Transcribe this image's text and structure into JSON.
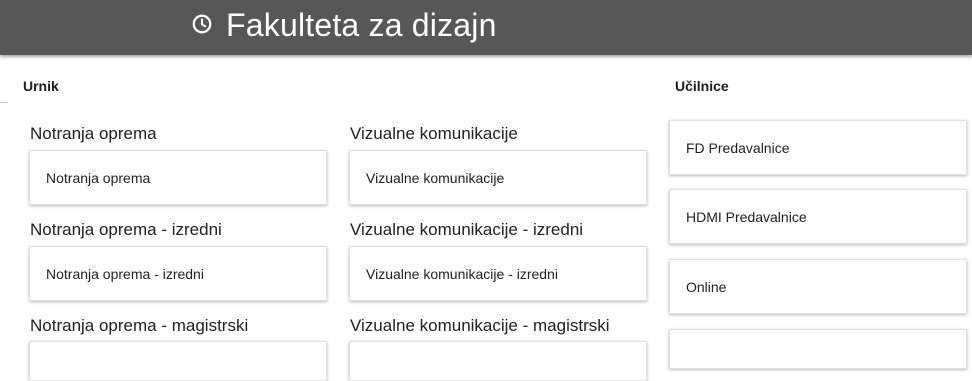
{
  "header": {
    "title": "Fakulteta za dizajn",
    "icon": "clock-icon",
    "background": "#575757"
  },
  "schedule": {
    "label": "Urnik",
    "groups": [
      {
        "title": "Notranja oprema",
        "card": "Notranja oprema"
      },
      {
        "title": "Vizualne komunikacije",
        "card": "Vizualne komunikacije"
      },
      {
        "title": "Notranja oprema - izredni",
        "card": "Notranja oprema - izredni"
      },
      {
        "title": "Vizualne komunikacije - izredni",
        "card": "Vizualne komunikacije - izredni"
      },
      {
        "title": "Notranja oprema - magistrski",
        "card": ""
      },
      {
        "title": "Vizualne komunikacije - magistrski",
        "card": ""
      }
    ]
  },
  "classrooms": {
    "label": "Učilnice",
    "items": [
      "FD Predavalnice",
      "HDMI Predavalnice",
      "Online",
      ""
    ]
  }
}
